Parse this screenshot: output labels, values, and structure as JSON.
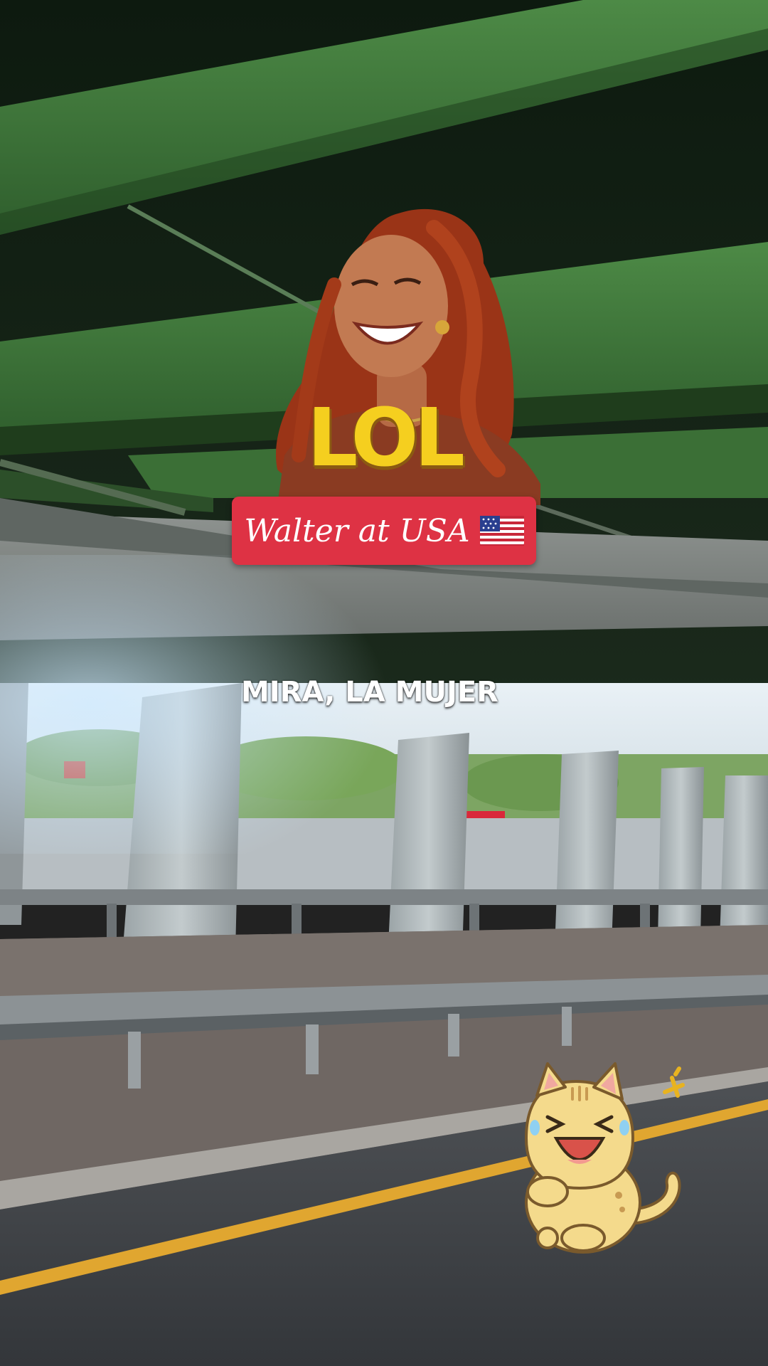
{
  "overlays": {
    "reaction_caption": "LOL",
    "title_banner": {
      "text": "Walter at USA",
      "flag_icon": "us-flag-icon",
      "background_color": "#de3244"
    },
    "subtitle": "MIRA, LA MUJER"
  },
  "stickers": [
    {
      "name": "laughing-woman-sticker",
      "description_icon": "laughing-person"
    },
    {
      "name": "laughing-cat-sticker",
      "description_icon": "crying-laughing-cat"
    }
  ],
  "scene": {
    "setting": "under highway overpass",
    "accent_colors": {
      "overpass_green": "#3f7a3a",
      "road_line_yellow": "#e0a630",
      "asphalt": "#3c3f44"
    }
  }
}
